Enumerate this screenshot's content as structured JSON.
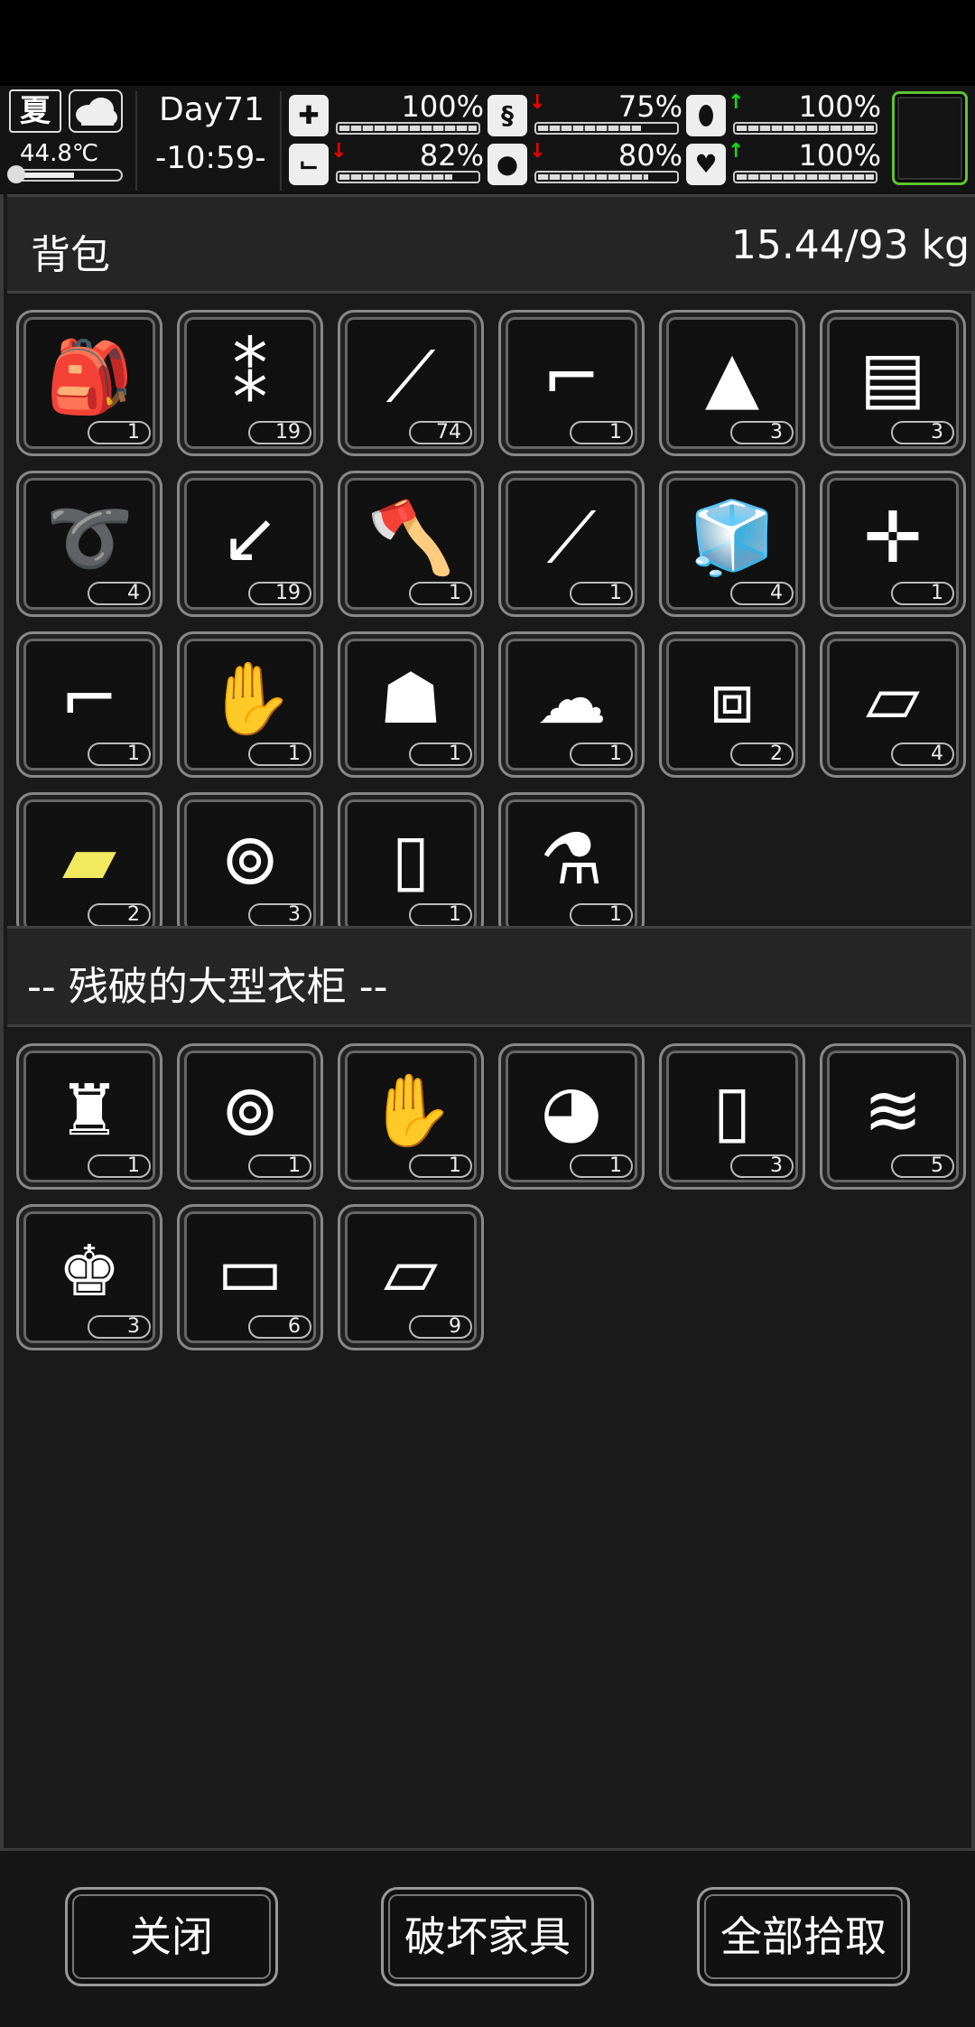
{
  "hud": {
    "season": "夏",
    "weather_icon": "cloud-icon",
    "temperature": "44.8℃",
    "day": "Day71",
    "time": "-10:59-",
    "stats": [
      {
        "name": "health",
        "icon": "medkit-icon",
        "value": "100%",
        "level": 1.0,
        "trend": ""
      },
      {
        "name": "hunger",
        "icon": "stomach-icon",
        "value": "75%",
        "level": 0.75,
        "trend": "down"
      },
      {
        "name": "pill",
        "icon": "pill-icon",
        "value": "100%",
        "level": 1.0,
        "trend": "up"
      },
      {
        "name": "stamina",
        "icon": "foot-icon",
        "value": "82%",
        "level": 0.82,
        "trend": "down"
      },
      {
        "name": "thirst",
        "icon": "water-drop-icon",
        "value": "80%",
        "level": 0.8,
        "trend": "down"
      },
      {
        "name": "mood",
        "icon": "heart-icon",
        "value": "100%",
        "level": 1.0,
        "trend": "up"
      }
    ]
  },
  "backpack": {
    "title": "背包",
    "weight": "15.44/93 kg",
    "items": [
      {
        "icon": "backpack-icon",
        "count": "1"
      },
      {
        "icon": "bullets-icon",
        "count": "19"
      },
      {
        "icon": "nails-icon",
        "count": "74"
      },
      {
        "icon": "nail-gun-icon",
        "count": "1"
      },
      {
        "icon": "cloth-scrap-icon",
        "count": "3"
      },
      {
        "icon": "towel-icon",
        "count": "3"
      },
      {
        "icon": "rope-icon",
        "count": "4"
      },
      {
        "icon": "arrow-icon",
        "count": "19"
      },
      {
        "icon": "axe-icon",
        "count": "1"
      },
      {
        "icon": "shovel-icon",
        "count": "1"
      },
      {
        "icon": "ice-cube-icon",
        "count": "4"
      },
      {
        "icon": "crossbow-icon",
        "count": "1"
      },
      {
        "icon": "pistol-icon",
        "count": "1"
      },
      {
        "icon": "gloves-icon",
        "count": "1"
      },
      {
        "icon": "cloak-icon",
        "count": "1"
      },
      {
        "icon": "hat-icon",
        "count": "1"
      },
      {
        "icon": "toolbox-icon",
        "count": "2"
      },
      {
        "icon": "fabric-icon",
        "count": "4"
      },
      {
        "icon": "yellow-cloth-icon",
        "count": "2",
        "highlight": true
      },
      {
        "icon": "fabric-roll-icon",
        "count": "3"
      },
      {
        "icon": "cloth-sheet-icon",
        "count": "1"
      },
      {
        "icon": "test-tube-icon",
        "count": "1"
      }
    ]
  },
  "container": {
    "title": "-- 残破的大型衣柜 --",
    "items": [
      {
        "icon": "fur-coat-icon",
        "count": "1"
      },
      {
        "icon": "fabric-roll-icon",
        "count": "1"
      },
      {
        "icon": "fingerless-gloves-icon",
        "count": "1"
      },
      {
        "icon": "cap-icon",
        "count": "1"
      },
      {
        "icon": "cloth-sheet-icon",
        "count": "3"
      },
      {
        "icon": "folded-clothes-icon",
        "count": "5"
      },
      {
        "icon": "torn-shirt-icon",
        "count": "3"
      },
      {
        "icon": "cloth-fold-icon",
        "count": "6"
      },
      {
        "icon": "fabric-icon",
        "count": "9"
      }
    ]
  },
  "buttons": {
    "close": "关闭",
    "destroy": "破坏家具",
    "take_all": "全部拾取"
  }
}
